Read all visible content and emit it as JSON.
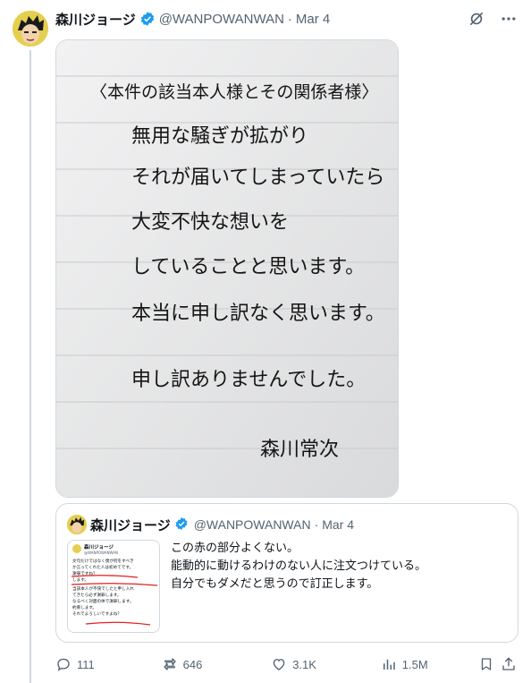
{
  "author": {
    "name": "森川ジョージ",
    "handle": "@WANPOWANWAN",
    "separator": "·",
    "date": "Mar 4"
  },
  "image": {
    "lines": [
      "〈本件の該当本人様とその関係者様〉",
      "無用な騒ぎが拡がり",
      "それが届いてしまっていたら",
      "大変不快な想いを",
      "していることと思います。",
      "本当に申し訳なく思います。",
      "申し訳ありませんでした。"
    ],
    "signature": "森川常次"
  },
  "quote": {
    "name": "森川ジョージ",
    "handle": "@WANPOWANWAN",
    "separator": "·",
    "date": "Mar 4",
    "text_lines": [
      "この赤の部分よくない。",
      "能動的に動けるわけのない人に注文つけている。",
      "自分でもダメだと思うので訂正します。"
    ],
    "thumb": {
      "name": "森川ジョージ",
      "handle": "@WANPOWANWAN",
      "lines": [
        "文句だけではなく僕が何をすべき",
        "か言ってくれた人は初めてです。",
        "謝罪ですね？",
        "します。",
        "当該本人が不快でしたと申し入れ",
        "てきたら必ず謝罪します。",
        "なるべく対面の体で謝罪します。",
        "約束します。",
        "それでよろしいですよね？"
      ]
    }
  },
  "actions": {
    "replies": "111",
    "reposts": "646",
    "likes": "3.1K",
    "views": "1.5M"
  },
  "colors": {
    "accent": "#1d9bf0",
    "muted": "#536471",
    "border": "#cfd9de",
    "paper": "#ecedee",
    "ink": "#111111"
  }
}
